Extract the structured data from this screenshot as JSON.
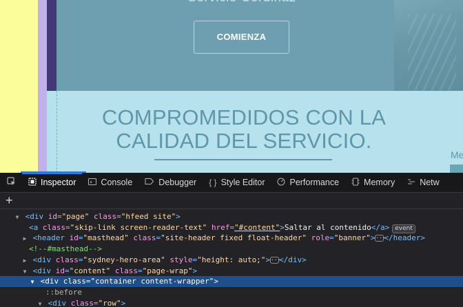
{
  "page": {
    "hero_title_partial": "Servicio Cordinaz",
    "cta_label": "COMIENZA",
    "heading_line1": "COMPROMEDIDOS CON LA",
    "heading_line2": "CALIDAD DEL SERVICIO.",
    "side_text": "Me"
  },
  "devtools": {
    "tabs": [
      {
        "label": "Inspector",
        "icon": "inspector-icon"
      },
      {
        "label": "Console",
        "icon": "console-icon"
      },
      {
        "label": "Debugger",
        "icon": "debugger-icon"
      },
      {
        "label": "Style Editor",
        "icon": "style-editor-icon"
      },
      {
        "label": "Performance",
        "icon": "performance-icon"
      },
      {
        "label": "Memory",
        "icon": "memory-icon"
      },
      {
        "label": "Netw",
        "icon": "network-icon"
      }
    ],
    "active_tab": "Inspector",
    "add_node": "+",
    "markup": {
      "l1": {
        "tag_open": "<div",
        "id_attr": "id",
        "id_val": "\"page\"",
        "class_attr": "class",
        "class_val": "\"hfeed site\"",
        "close": ">"
      },
      "l2": {
        "tag_open": "<a",
        "class_attr": "class",
        "class_val": "\"skip-link screen-reader-text\"",
        "href_attr": "href",
        "href_val": "\"#content\"",
        "close": ">",
        "text": "Saltar al contenido",
        "end": "</a>",
        "badge": "event"
      },
      "l3": {
        "tag_open": "<header",
        "id_attr": "id",
        "id_val": "\"masthead\"",
        "class_attr": "class",
        "class_val": "\"site-header fixed float-header\"",
        "role_attr": "role",
        "role_val": "\"banner\"",
        "close": ">",
        "end": "</header>"
      },
      "l4": {
        "comment": "<!--#masthead-->"
      },
      "l5": {
        "tag_open": "<div",
        "class_attr": "class",
        "class_val": "\"sydney-hero-area\"",
        "style_attr": "style",
        "style_val": "\"height: auto;\"",
        "close": ">",
        "end": "</div>"
      },
      "l6": {
        "tag_open": "<div",
        "id_attr": "id",
        "id_val": "\"content\"",
        "class_attr": "class",
        "class_val": "\"page-wrap\"",
        "close": ">"
      },
      "l7": {
        "tag_open": "<div",
        "class_attr": "class",
        "class_val": "\"container content-wrapper\"",
        "close": ">"
      },
      "l8": {
        "pseudo": "::before"
      },
      "l9": {
        "tag_open": "<div",
        "class_attr": "class",
        "class_val": "\"row\"",
        "close": ">"
      }
    }
  },
  "colors": {
    "accent_blue": "#0a84ff",
    "selected_row": "#204e8a",
    "heading_teal": "#5f97a8"
  }
}
